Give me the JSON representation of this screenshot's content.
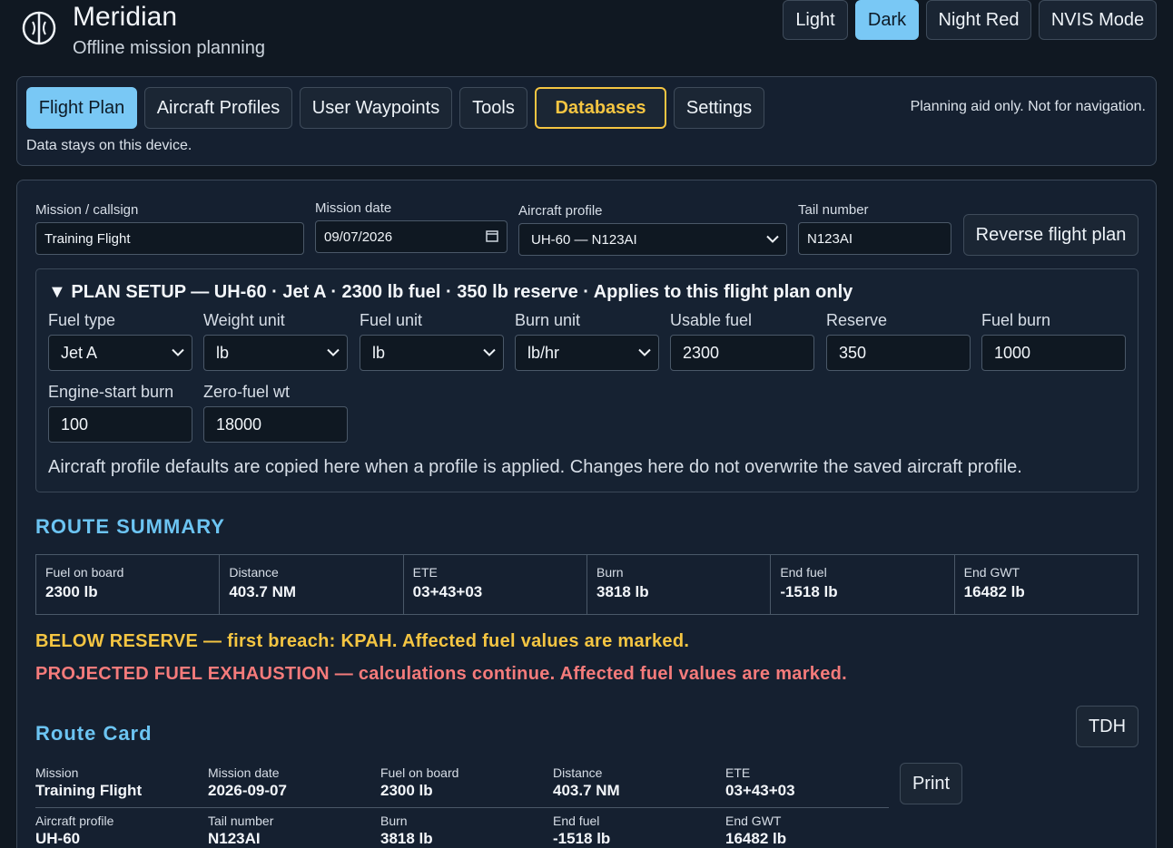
{
  "header": {
    "title": "Meridian",
    "subtitle": "Offline mission planning",
    "themes": [
      "Light",
      "Dark",
      "Night Red",
      "NVIS Mode"
    ],
    "active_theme": "Dark"
  },
  "nav": {
    "tabs": [
      "Flight Plan",
      "Aircraft Profiles",
      "User Waypoints",
      "Tools",
      "Databases",
      "Settings"
    ],
    "active_tab": "Flight Plan",
    "highlighted_tab": "Databases",
    "disclaimer": "Planning aid only. Not for navigation.",
    "note": "Data stays on this device."
  },
  "mission": {
    "callsign_label": "Mission / callsign",
    "callsign_value": "Training Flight",
    "date_label": "Mission date",
    "date_value": "09/07/2026",
    "profile_label": "Aircraft profile",
    "profile_value": "UH-60 — N123AI",
    "tail_label": "Tail number",
    "tail_value": "N123AI",
    "reverse_button": "Reverse flight plan"
  },
  "plan_setup": {
    "title": "▼ PLAN SETUP — UH-60 · Jet A · 2300 lb fuel · 350 lb reserve · Applies to this flight plan only",
    "fields": [
      {
        "label": "Fuel type",
        "value": "Jet A",
        "type": "select"
      },
      {
        "label": "Weight unit",
        "value": "lb",
        "type": "select"
      },
      {
        "label": "Fuel unit",
        "value": "lb",
        "type": "select"
      },
      {
        "label": "Burn unit",
        "value": "lb/hr",
        "type": "select"
      },
      {
        "label": "Usable fuel",
        "value": "2300",
        "type": "input"
      },
      {
        "label": "Reserve",
        "value": "350",
        "type": "input"
      },
      {
        "label": "Fuel burn",
        "value": "1000",
        "type": "input"
      },
      {
        "label": "Engine-start burn",
        "value": "100",
        "type": "input"
      },
      {
        "label": "Zero-fuel wt",
        "value": "18000",
        "type": "input"
      }
    ],
    "note": "Aircraft profile defaults are copied here when a profile is applied. Changes here do not overwrite the saved aircraft profile."
  },
  "route_summary": {
    "title": "ROUTE SUMMARY",
    "cells": [
      {
        "label": "Fuel on board",
        "value": "2300 lb"
      },
      {
        "label": "Distance",
        "value": "403.7 NM"
      },
      {
        "label": "ETE",
        "value": "03+43+03"
      },
      {
        "label": "Burn",
        "value": "3818 lb"
      },
      {
        "label": "End fuel",
        "value": "-1518 lb"
      },
      {
        "label": "End GWT",
        "value": "16482 lb"
      }
    ]
  },
  "alerts": {
    "reserve": "BELOW RESERVE — first breach: KPAH. Affected fuel values are marked.",
    "exhaustion": "PROJECTED FUEL EXHAUSTION — calculations continue. Affected fuel values are marked.",
    "reserve_color": "#f4c542",
    "exhaustion_color": "#f57b7b"
  },
  "route_card": {
    "title": "Route Card",
    "tdh_button": "TDH",
    "print_button": "Print",
    "row1": [
      {
        "label": "Mission",
        "value": "Training Flight"
      },
      {
        "label": "Mission date",
        "value": "2026-09-07"
      },
      {
        "label": "Fuel on board",
        "value": "2300 lb"
      },
      {
        "label": "Distance",
        "value": "403.7 NM"
      },
      {
        "label": "ETE",
        "value": "03+43+03"
      }
    ],
    "row2": [
      {
        "label": "Aircraft profile",
        "value": "UH-60"
      },
      {
        "label": "Tail number",
        "value": "N123AI"
      },
      {
        "label": "Burn",
        "value": "3818 lb"
      },
      {
        "label": "End fuel",
        "value": "-1518 lb"
      },
      {
        "label": "End GWT",
        "value": "16482 lb"
      }
    ]
  },
  "colors": {
    "accent": "#79c8f5",
    "section_title": "#6cc4f2",
    "background": "#101822",
    "panel": "#152030"
  }
}
